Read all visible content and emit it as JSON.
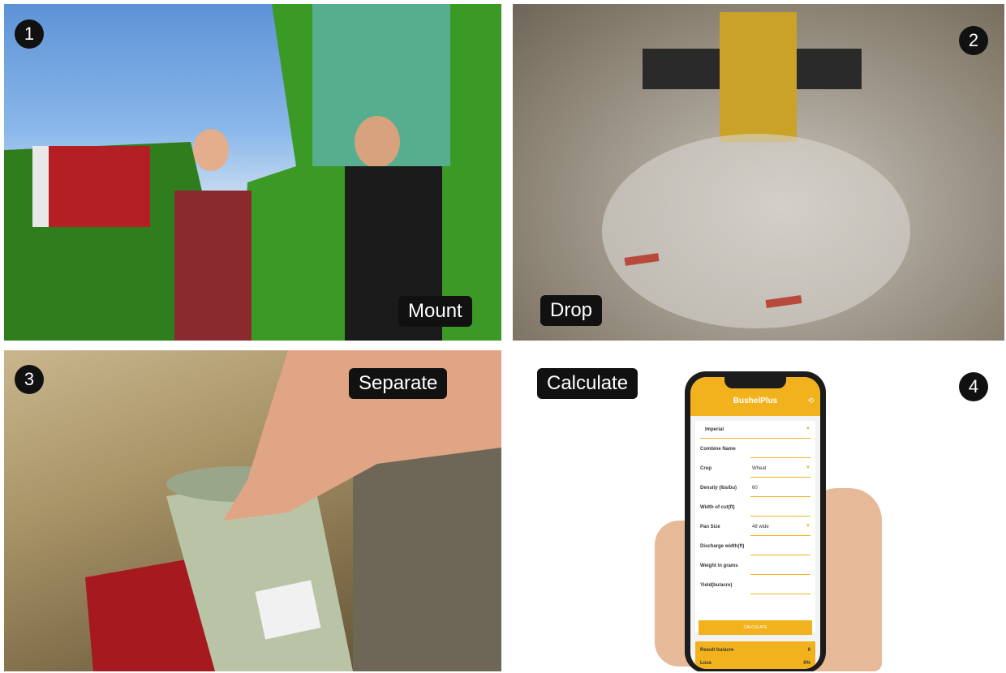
{
  "panels": [
    {
      "number": "1",
      "label": "Mount"
    },
    {
      "number": "2",
      "label": "Drop"
    },
    {
      "number": "3",
      "label": "Separate"
    },
    {
      "number": "4",
      "label": "Calculate"
    }
  ],
  "phone_app": {
    "title": "BushelPlus",
    "unit_select": "Imperial",
    "fields": [
      {
        "label": "Combine Name",
        "value": ""
      },
      {
        "label": "Crop",
        "value": "Wheat"
      },
      {
        "label": "Density (lbs/bu)",
        "value": "60"
      },
      {
        "label": "Width of cut(ft)",
        "value": ""
      },
      {
        "label": "Pan Size",
        "value": "48 wide"
      },
      {
        "label": "Discharge width(ft)",
        "value": ""
      },
      {
        "label": "Weight in grams",
        "value": ""
      },
      {
        "label": "Yield(bu/acre)",
        "value": ""
      }
    ],
    "button": "CALCULATE",
    "results": [
      {
        "label": "Result bu/acre",
        "value": "0"
      },
      {
        "label": "Loss",
        "value": "0%"
      }
    ]
  },
  "colors": {
    "accent": "#f2b21e",
    "badge": "#111111"
  }
}
